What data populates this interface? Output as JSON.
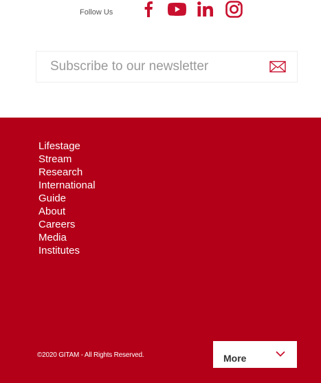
{
  "social": {
    "label": "Follow Us",
    "links": [
      {
        "name": "facebook",
        "icon": "facebook-icon"
      },
      {
        "name": "youtube",
        "icon": "youtube-icon"
      },
      {
        "name": "linkedin",
        "icon": "linkedin-icon"
      },
      {
        "name": "instagram",
        "icon": "instagram-icon"
      }
    ]
  },
  "newsletter": {
    "placeholder": "Subscribe to our newsletter",
    "submit_icon": "envelope-icon"
  },
  "footer": {
    "nav": [
      {
        "label": "Lifestage"
      },
      {
        "label": "Stream"
      },
      {
        "label": "Research"
      },
      {
        "label": "International"
      },
      {
        "label": "Guide"
      },
      {
        "label": "About"
      },
      {
        "label": "Careers"
      },
      {
        "label": "Media"
      },
      {
        "label": "Institutes"
      }
    ],
    "copyright": "©2020 GITAM - All Rights Reserved.",
    "more_label": "More",
    "more_icon": "chevron-down-icon"
  },
  "colors": {
    "brand_red": "#b30018",
    "icon_red": "#c8102e",
    "text_white": "#ffffff"
  }
}
